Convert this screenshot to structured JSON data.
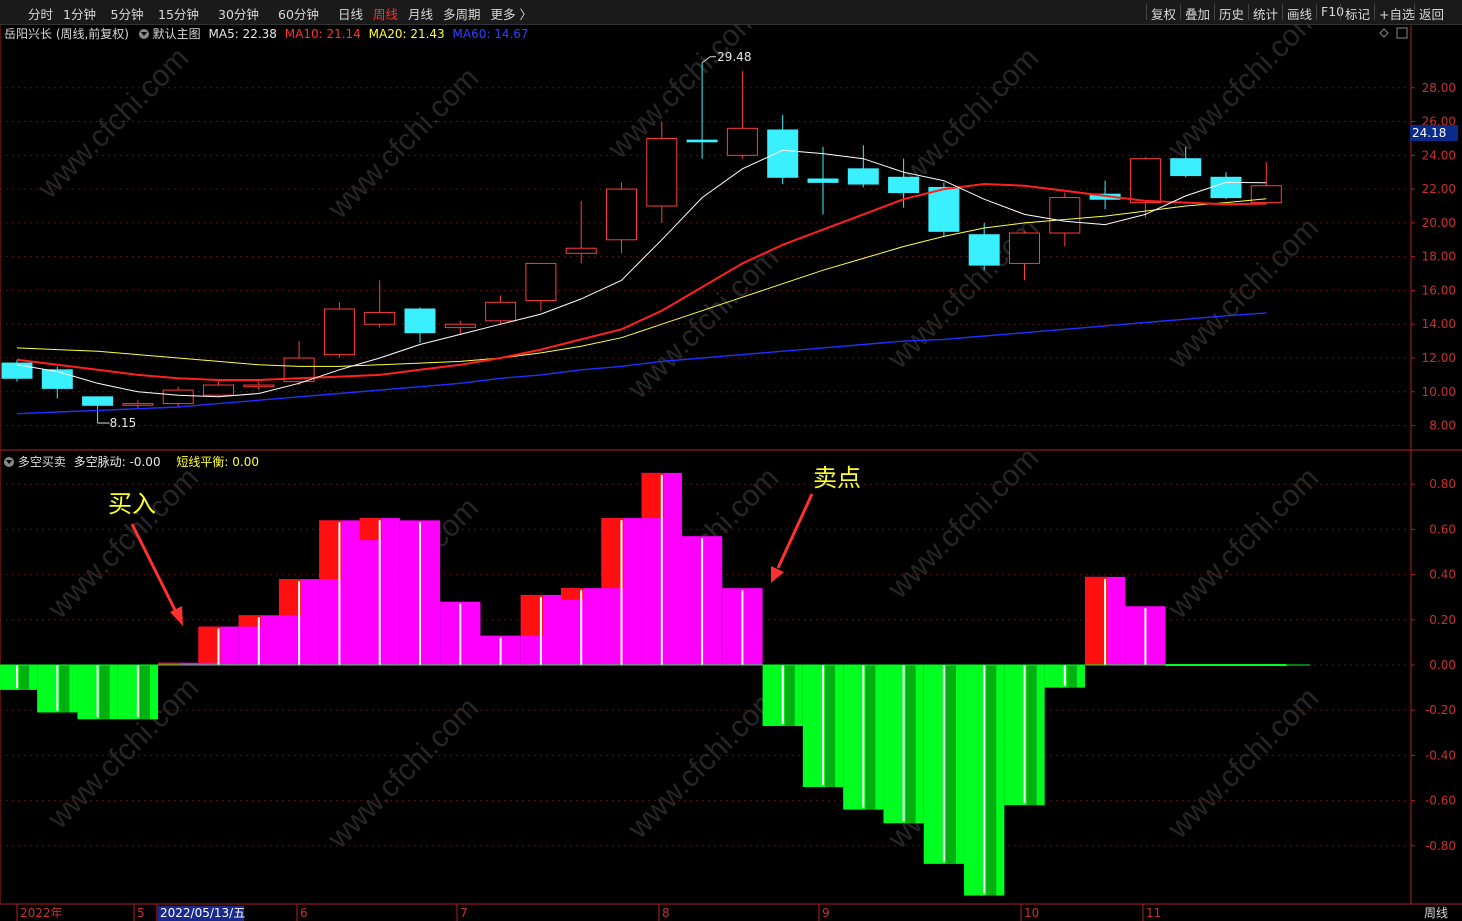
{
  "toolbar": {
    "left_items": [
      "分时",
      "1分钟",
      "5分钟",
      "15分钟",
      "30分钟",
      "60分钟",
      "日线",
      "周线",
      "月线",
      "多周期",
      "更多 〉"
    ],
    "active": "周线",
    "right_items": [
      "复权",
      "叠加",
      "历史",
      "统计",
      "画线",
      "F10",
      "标记",
      "+自选",
      "返回"
    ]
  },
  "main_header": {
    "stock": "岳阳兴长 (周线,前复权)",
    "template": "默认主图",
    "ma5": "MA5: 22.38",
    "ma10": "MA10: 21.14",
    "ma20": "MA20: 21.43",
    "ma60": "MA60: 14.67"
  },
  "sub_header": {
    "name": "多空买卖",
    "pulse": "多空脉动: -0.00",
    "balance": "短线平衡: 0.00"
  },
  "current_price": "24.18",
  "annotations": {
    "buy": "买入",
    "sell": "卖点"
  },
  "watermark": "www.cfchi.com",
  "x_axis": {
    "labels": [
      {
        "text": "2022年",
        "date_box": false
      },
      {
        "text": "5",
        "date_box": false
      },
      {
        "text": "2022/05/13/五",
        "date_box": true
      },
      {
        "text": "6",
        "date_box": false
      },
      {
        "text": "7",
        "date_box": false
      },
      {
        "text": "8",
        "date_box": false
      },
      {
        "text": "9",
        "date_box": false
      },
      {
        "text": "10",
        "date_box": false
      },
      {
        "text": "11",
        "date_box": false
      }
    ],
    "period": "周线"
  },
  "chart_data": [
    {
      "type": "candlestick",
      "title": "岳阳兴长 (周线,前复权)",
      "y_ticks": [
        "28.00",
        "26.00",
        "24.00",
        "22.00",
        "20.00",
        "18.00",
        "16.00",
        "14.00",
        "12.00",
        "10.00",
        "8.00"
      ],
      "ylim": [
        7.5,
        30.0
      ],
      "high_label": "29.48",
      "low_label": "8.15",
      "colors": {
        "up": "#ff3c3c",
        "down": "#3af0ff",
        "ma5": "#ffffff",
        "ma10": "#ff2020",
        "ma20": "#ffff40",
        "ma60": "#2030ff"
      },
      "candles": [
        {
          "o": 11.7,
          "h": 11.9,
          "l": 10.6,
          "c": 10.8
        },
        {
          "o": 11.3,
          "h": 11.5,
          "l": 9.6,
          "c": 10.2
        },
        {
          "o": 9.7,
          "h": 9.7,
          "l": 8.15,
          "c": 9.2
        },
        {
          "o": 9.2,
          "h": 9.5,
          "l": 9.0,
          "c": 9.3
        },
        {
          "o": 9.3,
          "h": 10.3,
          "l": 9.1,
          "c": 10.1
        },
        {
          "o": 9.8,
          "h": 10.6,
          "l": 9.7,
          "c": 10.4
        },
        {
          "o": 10.3,
          "h": 10.6,
          "l": 10.1,
          "c": 10.4
        },
        {
          "o": 10.6,
          "h": 13.0,
          "l": 10.4,
          "c": 12.0
        },
        {
          "o": 12.2,
          "h": 15.3,
          "l": 12.0,
          "c": 14.9
        },
        {
          "o": 14.0,
          "h": 16.6,
          "l": 13.8,
          "c": 14.7
        },
        {
          "o": 14.9,
          "h": 15.0,
          "l": 12.9,
          "c": 13.5
        },
        {
          "o": 13.8,
          "h": 14.2,
          "l": 13.4,
          "c": 14.0
        },
        {
          "o": 14.2,
          "h": 15.7,
          "l": 14.0,
          "c": 15.3
        },
        {
          "o": 15.4,
          "h": 17.6,
          "l": 14.8,
          "c": 17.6
        },
        {
          "o": 18.2,
          "h": 21.3,
          "l": 17.6,
          "c": 18.5
        },
        {
          "o": 19.0,
          "h": 22.4,
          "l": 18.2,
          "c": 22.0
        },
        {
          "o": 21.0,
          "h": 26.0,
          "l": 20.0,
          "c": 25.0
        },
        {
          "o": 24.9,
          "h": 29.48,
          "l": 23.8,
          "c": 24.8
        },
        {
          "o": 24.0,
          "h": 29.0,
          "l": 23.8,
          "c": 25.6
        },
        {
          "o": 25.5,
          "h": 26.4,
          "l": 22.3,
          "c": 22.7
        },
        {
          "o": 22.6,
          "h": 24.5,
          "l": 20.5,
          "c": 22.4
        },
        {
          "o": 23.2,
          "h": 24.6,
          "l": 22.1,
          "c": 22.3
        },
        {
          "o": 22.7,
          "h": 23.8,
          "l": 20.9,
          "c": 21.8
        },
        {
          "o": 22.1,
          "h": 22.4,
          "l": 19.2,
          "c": 19.5
        },
        {
          "o": 19.3,
          "h": 20.0,
          "l": 17.2,
          "c": 17.5
        },
        {
          "o": 17.6,
          "h": 19.5,
          "l": 16.6,
          "c": 19.4
        },
        {
          "o": 19.4,
          "h": 21.8,
          "l": 18.6,
          "c": 21.5
        },
        {
          "o": 21.7,
          "h": 22.5,
          "l": 20.8,
          "c": 21.4
        },
        {
          "o": 21.2,
          "h": 23.9,
          "l": 20.3,
          "c": 23.8
        },
        {
          "o": 23.8,
          "h": 24.5,
          "l": 22.7,
          "c": 22.8
        },
        {
          "o": 22.7,
          "h": 23.0,
          "l": 21.4,
          "c": 21.5
        },
        {
          "o": 21.2,
          "h": 23.6,
          "l": 21.1,
          "c": 22.2
        }
      ],
      "ma5": [
        11.6,
        11.2,
        10.5,
        10.0,
        9.8,
        9.7,
        9.9,
        10.5,
        11.3,
        12.0,
        12.8,
        13.4,
        14.0,
        14.6,
        15.5,
        16.6,
        19.0,
        21.5,
        23.2,
        24.3,
        24.1,
        23.8,
        23.0,
        22.5,
        21.4,
        20.5,
        20.1,
        19.9,
        20.5,
        21.6,
        22.4,
        22.38
      ],
      "ma10": [
        11.9,
        11.6,
        11.3,
        11.0,
        10.8,
        10.7,
        10.7,
        10.8,
        10.9,
        11.0,
        11.3,
        11.6,
        12.0,
        12.5,
        13.1,
        13.7,
        14.8,
        16.2,
        17.6,
        18.7,
        19.6,
        20.5,
        21.4,
        22.0,
        22.3,
        22.2,
        21.9,
        21.6,
        21.3,
        21.2,
        21.1,
        21.14
      ],
      "ma20": [
        12.6,
        12.5,
        12.4,
        12.2,
        12.0,
        11.8,
        11.6,
        11.5,
        11.5,
        11.6,
        11.7,
        11.8,
        12.0,
        12.3,
        12.7,
        13.2,
        14.0,
        14.8,
        15.6,
        16.4,
        17.2,
        17.9,
        18.6,
        19.2,
        19.7,
        20.0,
        20.2,
        20.4,
        20.7,
        21.0,
        21.2,
        21.43
      ],
      "ma60": [
        8.7,
        8.8,
        8.9,
        9.0,
        9.1,
        9.3,
        9.5,
        9.7,
        9.9,
        10.1,
        10.3,
        10.5,
        10.8,
        11.0,
        11.3,
        11.5,
        11.8,
        12.0,
        12.2,
        12.4,
        12.6,
        12.8,
        13.0,
        13.1,
        13.3,
        13.5,
        13.7,
        13.9,
        14.1,
        14.3,
        14.5,
        14.67
      ]
    },
    {
      "type": "bar",
      "title": "多空买卖",
      "y_ticks": [
        "0.80",
        "0.60",
        "0.40",
        "0.20",
        "0.00",
        "-0.20",
        "-0.40",
        "-0.60",
        "-0.80"
      ],
      "ylim": [
        -1.02,
        0.96
      ],
      "colors": {
        "pos": "#ff00ff",
        "pos_dark": "#d000d0",
        "pos_edge": "#ff1010",
        "neg": "#00ff20",
        "neg_dark": "#00b010",
        "tick": "#ffffff"
      },
      "values": [
        -0.11,
        -0.21,
        -0.24,
        -0.24,
        0.01,
        0.17,
        0.22,
        0.38,
        0.64,
        0.65,
        0.64,
        0.28,
        0.13,
        0.31,
        0.34,
        0.65,
        0.85,
        0.57,
        0.34,
        -0.27,
        -0.54,
        -0.64,
        -0.7,
        -0.88,
        -1.02,
        -0.62,
        -0.1,
        0.39,
        0.26,
        0.0,
        0.0,
        0.0
      ]
    }
  ]
}
